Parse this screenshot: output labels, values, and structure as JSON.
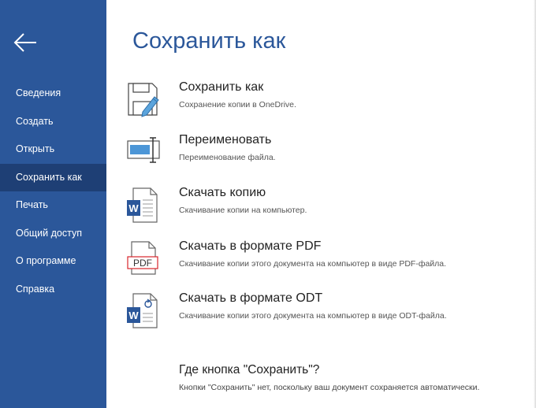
{
  "sidebar": {
    "back_icon": "arrow-left-icon",
    "items": [
      {
        "label": "Сведения",
        "active": false
      },
      {
        "label": "Создать",
        "active": false
      },
      {
        "label": "Открыть",
        "active": false
      },
      {
        "label": "Сохранить как",
        "active": true
      },
      {
        "label": "Печать",
        "active": false
      },
      {
        "label": "Общий доступ",
        "active": false
      },
      {
        "label": "О программе",
        "active": false
      },
      {
        "label": "Справка",
        "active": false
      }
    ]
  },
  "main": {
    "title": "Сохранить как",
    "options": [
      {
        "icon": "save-as-icon",
        "title": "Сохранить как",
        "desc": "Сохранение копии в OneDrive."
      },
      {
        "icon": "rename-icon",
        "title": "Переименовать",
        "desc": "Переименование файла."
      },
      {
        "icon": "word-document-icon",
        "title": "Скачать копию",
        "desc": "Скачивание копии на компьютер."
      },
      {
        "icon": "pdf-document-icon",
        "title": "Скачать в формате PDF",
        "desc": "Скачивание копии этого документа на компьютер в виде PDF-файла.",
        "badge": "PDF"
      },
      {
        "icon": "odt-document-icon",
        "title": "Скачать в формате ODT",
        "desc": "Скачивание копии этого документа на компьютер в виде ODT-файла."
      }
    ],
    "help": {
      "title": "Где кнопка \"Сохранить\"?",
      "desc": "Кнопки \"Сохранить\" нет, поскольку ваш документ сохраняется автоматически."
    }
  },
  "colors": {
    "sidebar_bg": "#2b579a",
    "sidebar_active": "#1e3f75",
    "title_blue": "#2b579a",
    "pdf_red": "#d9262c"
  }
}
